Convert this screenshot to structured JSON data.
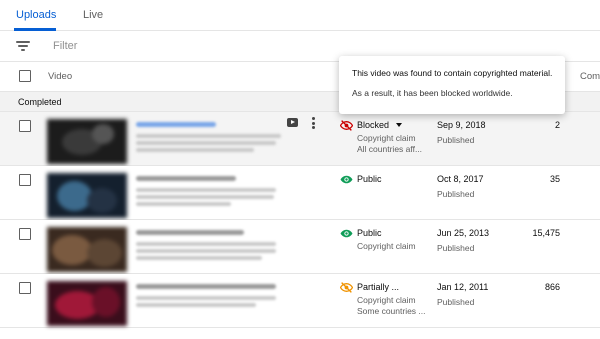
{
  "tabs": [
    {
      "label": "Uploads",
      "active": true
    },
    {
      "label": "Live",
      "active": false
    }
  ],
  "filter": {
    "placeholder": "Filter",
    "icon": "filter-icon"
  },
  "table": {
    "header_video": "Video",
    "header_comments": "Comm"
  },
  "section": {
    "label": "Completed"
  },
  "tooltip": {
    "title": "This video was found to contain copyrighted material.",
    "body": "As a result, it has been blocked worldwide."
  },
  "colors": {
    "accent": "#065fd4",
    "blocked_icon": "#cc0000",
    "public_icon": "#0f9d58",
    "partial_icon": "#f09300"
  },
  "rows": [
    {
      "visibility": "Blocked",
      "visibility_icon": "blocked-eye-icon",
      "has_dropdown": true,
      "restrictions": [
        "Copyright claim",
        "All countries aff..."
      ],
      "date": "Sep 9, 2018",
      "date_sub": "Published",
      "views": "2",
      "hovered": true
    },
    {
      "visibility": "Public",
      "visibility_icon": "eye-icon",
      "restrictions": [],
      "date": "Oct 8, 2017",
      "date_sub": "Published",
      "views": "35"
    },
    {
      "visibility": "Public",
      "visibility_icon": "eye-icon",
      "restrictions": [
        "Copyright claim"
      ],
      "date": "Jun 25, 2013",
      "date_sub": "Published",
      "views": "15,475"
    },
    {
      "visibility": "Partially ...",
      "visibility_icon": "partial-eye-icon",
      "restrictions": [
        "Copyright claim",
        "Some countries ..."
      ],
      "date": "Jan 12, 2011",
      "date_sub": "Published",
      "views": "866"
    }
  ]
}
